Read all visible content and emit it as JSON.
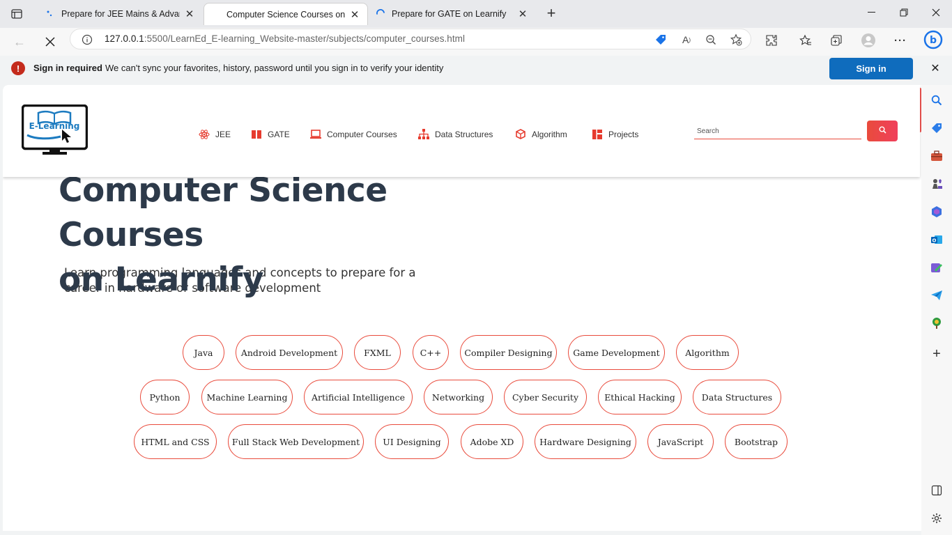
{
  "browser": {
    "tabs": [
      {
        "title": "Prepare for JEE Mains & Advance",
        "active": false
      },
      {
        "title": "Computer Science Courses on Le",
        "active": true
      },
      {
        "title": "Prepare for GATE on Learnify",
        "active": false
      }
    ],
    "url_host": "127.0.0.1",
    "url_path": ":5500/LearnEd_E-learning_Website-master/subjects/computer_courses.html"
  },
  "infobar": {
    "title": "Sign in required",
    "message": "We can't sync your favorites, history, password until you sign in to verify your identity",
    "button": "Sign in"
  },
  "site": {
    "logo_text": "E-Learning",
    "menu": [
      {
        "label": "JEE",
        "icon": "atom-icon"
      },
      {
        "label": "GATE",
        "icon": "book-icon"
      },
      {
        "label": "Computer Courses",
        "icon": "laptop-icon"
      },
      {
        "label": "Data Structures",
        "icon": "sitemap-icon"
      },
      {
        "label": "Algorithm",
        "icon": "cubes-icon"
      },
      {
        "label": "Projects",
        "icon": "dashboard-icon"
      }
    ],
    "search_placeholder": "Search",
    "accent_color": "#e94b3c"
  },
  "hero": {
    "title_line1": "Computer Science Courses",
    "title_line2": "on Learnify",
    "subtitle": "Learn programming languages and concepts to prepare for a career in hardware or software development"
  },
  "courses": {
    "row1": [
      "Java",
      "Android Development",
      "FXML",
      "C++",
      "Compiler Designing",
      "Game Development",
      "Algorithm"
    ],
    "row2": [
      "Python",
      "Machine Learning",
      "Artificial Intelligence",
      "Networking",
      "Cyber Security",
      "Ethical Hacking",
      "Data Structures"
    ],
    "row3": [
      "HTML and CSS",
      "Full Stack Web Development",
      "UI Designing",
      "Adobe XD",
      "Hardware Designing",
      "JavaScript",
      "Bootstrap"
    ]
  }
}
